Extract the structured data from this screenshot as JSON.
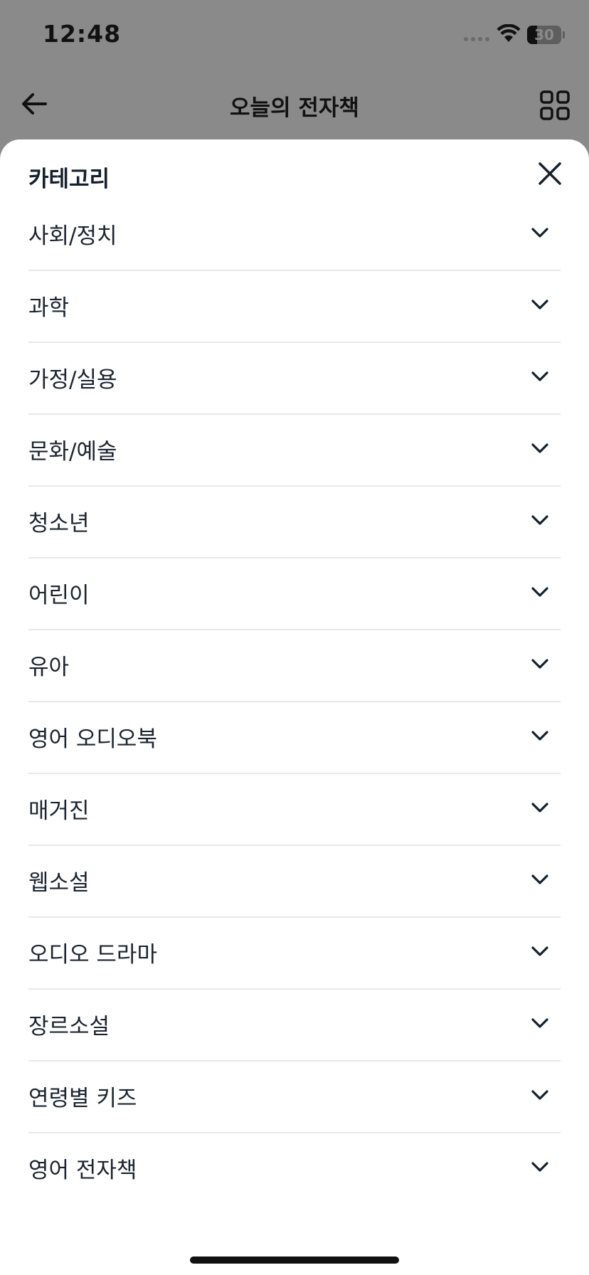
{
  "status_bar": {
    "time": "12:48",
    "battery_percent": 30,
    "battery_label": "30",
    "signal_icon": "signal-dots-icon",
    "wifi_icon": "wifi-icon"
  },
  "header": {
    "title": "오늘의 전자책",
    "back_icon": "arrow-left-icon",
    "grid_icon": "grid-icon"
  },
  "sheet": {
    "title": "카테고리",
    "close_icon": "close-icon",
    "categories": [
      {
        "label": "사회/정치"
      },
      {
        "label": "과학"
      },
      {
        "label": "가정/실용"
      },
      {
        "label": "문화/예술"
      },
      {
        "label": "청소년"
      },
      {
        "label": "어린이"
      },
      {
        "label": "유아"
      },
      {
        "label": "영어 오디오북"
      },
      {
        "label": "매거진"
      },
      {
        "label": "웹소설"
      },
      {
        "label": "오디오 드라마"
      },
      {
        "label": "장르소설"
      },
      {
        "label": "연령별 키즈"
      },
      {
        "label": "영어 전자책"
      }
    ],
    "chevron_icon": "chevron-down-icon"
  },
  "colors": {
    "overlay": "#8a8a8a",
    "sheet_bg": "#ffffff",
    "text_dark": "#14202e",
    "divider": "#e6e8eb"
  }
}
